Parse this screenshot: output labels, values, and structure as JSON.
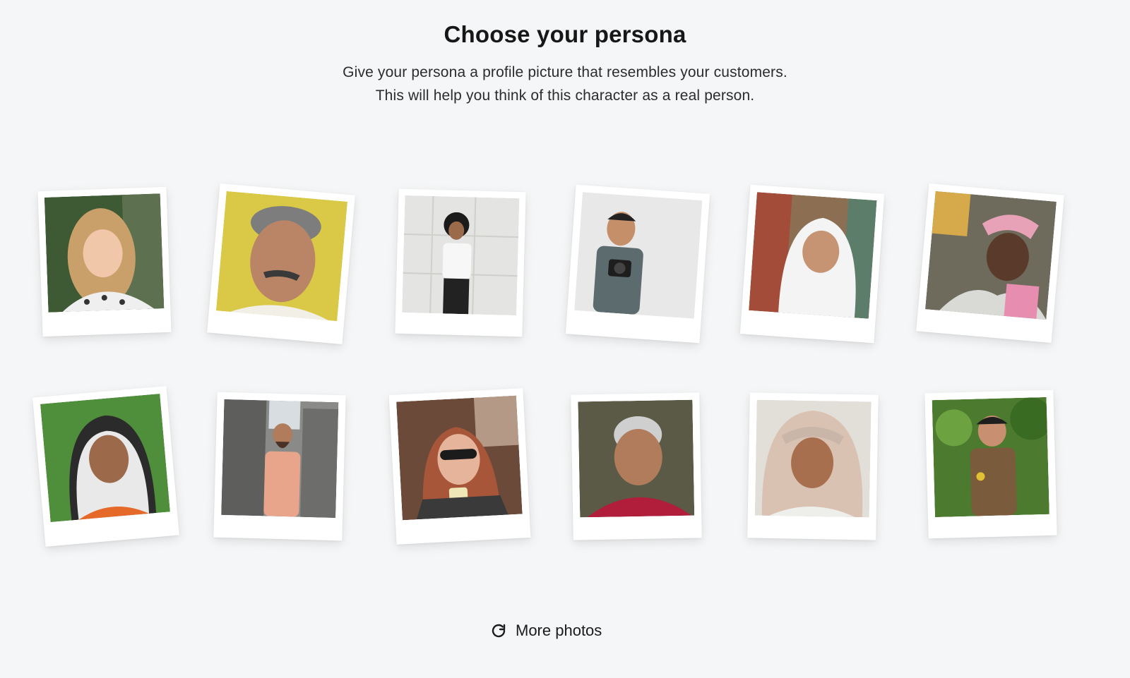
{
  "page": {
    "title": "Choose your persona",
    "subtitle_line1": "Give your persona a profile picture that resembles your customers.",
    "subtitle_line2": "This will help you think of this character as a real person."
  },
  "photos": [
    {
      "id": "woman-blonde-hair",
      "background": "#3e5a34"
    },
    {
      "id": "older-man-mustache",
      "background": "#d9c947"
    },
    {
      "id": "man-white-tshirt-wall",
      "background": "#e4e4e2"
    },
    {
      "id": "man-holding-camera",
      "background": "#e8e8e8"
    },
    {
      "id": "woman-white-hijab",
      "background": "#8c6f52"
    },
    {
      "id": "woman-headwrap-laughing",
      "background": "#6e6a5c"
    },
    {
      "id": "woman-patterned-headscarf",
      "background": "#4f8f3c"
    },
    {
      "id": "bearded-man-city-street",
      "background": "#8a8a88"
    },
    {
      "id": "woman-sunglasses-drink",
      "background": "#6b4a3a"
    },
    {
      "id": "elderly-man-red-shirt",
      "background": "#5a5a46"
    },
    {
      "id": "woman-beige-headscarf",
      "background": "#e2ded8"
    },
    {
      "id": "boy-brown-sweater",
      "background": "#4c7a2e"
    }
  ],
  "more_photos": {
    "label": "More photos",
    "icon": "refresh-icon"
  }
}
